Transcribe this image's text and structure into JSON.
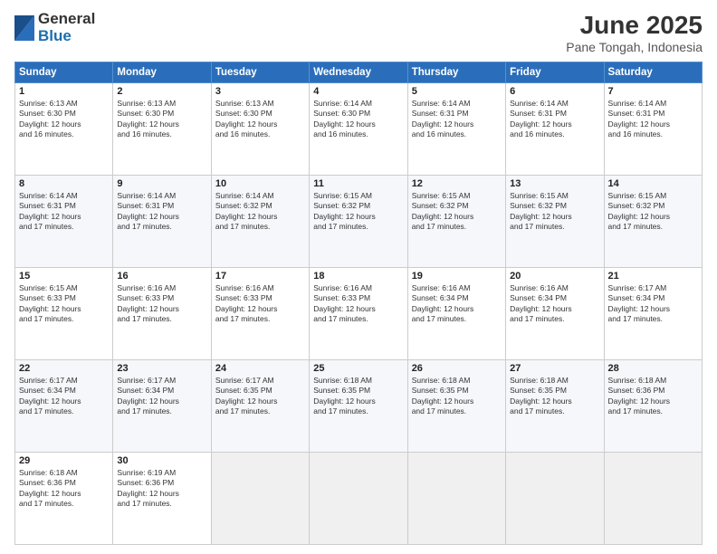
{
  "logo": {
    "general": "General",
    "blue": "Blue"
  },
  "title": "June 2025",
  "location": "Pane Tongah, Indonesia",
  "days_of_week": [
    "Sunday",
    "Monday",
    "Tuesday",
    "Wednesday",
    "Thursday",
    "Friday",
    "Saturday"
  ],
  "weeks": [
    [
      {
        "day": "1",
        "sunrise": "6:13 AM",
        "sunset": "6:30 PM",
        "daylight": "12 hours and 16 minutes."
      },
      {
        "day": "2",
        "sunrise": "6:13 AM",
        "sunset": "6:30 PM",
        "daylight": "12 hours and 16 minutes."
      },
      {
        "day": "3",
        "sunrise": "6:13 AM",
        "sunset": "6:30 PM",
        "daylight": "12 hours and 16 minutes."
      },
      {
        "day": "4",
        "sunrise": "6:14 AM",
        "sunset": "6:30 PM",
        "daylight": "12 hours and 16 minutes."
      },
      {
        "day": "5",
        "sunrise": "6:14 AM",
        "sunset": "6:31 PM",
        "daylight": "12 hours and 16 minutes."
      },
      {
        "day": "6",
        "sunrise": "6:14 AM",
        "sunset": "6:31 PM",
        "daylight": "12 hours and 16 minutes."
      },
      {
        "day": "7",
        "sunrise": "6:14 AM",
        "sunset": "6:31 PM",
        "daylight": "12 hours and 16 minutes."
      }
    ],
    [
      {
        "day": "8",
        "sunrise": "6:14 AM",
        "sunset": "6:31 PM",
        "daylight": "12 hours and 17 minutes."
      },
      {
        "day": "9",
        "sunrise": "6:14 AM",
        "sunset": "6:31 PM",
        "daylight": "12 hours and 17 minutes."
      },
      {
        "day": "10",
        "sunrise": "6:14 AM",
        "sunset": "6:32 PM",
        "daylight": "12 hours and 17 minutes."
      },
      {
        "day": "11",
        "sunrise": "6:15 AM",
        "sunset": "6:32 PM",
        "daylight": "12 hours and 17 minutes."
      },
      {
        "day": "12",
        "sunrise": "6:15 AM",
        "sunset": "6:32 PM",
        "daylight": "12 hours and 17 minutes."
      },
      {
        "day": "13",
        "sunrise": "6:15 AM",
        "sunset": "6:32 PM",
        "daylight": "12 hours and 17 minutes."
      },
      {
        "day": "14",
        "sunrise": "6:15 AM",
        "sunset": "6:32 PM",
        "daylight": "12 hours and 17 minutes."
      }
    ],
    [
      {
        "day": "15",
        "sunrise": "6:15 AM",
        "sunset": "6:33 PM",
        "daylight": "12 hours and 17 minutes."
      },
      {
        "day": "16",
        "sunrise": "6:16 AM",
        "sunset": "6:33 PM",
        "daylight": "12 hours and 17 minutes."
      },
      {
        "day": "17",
        "sunrise": "6:16 AM",
        "sunset": "6:33 PM",
        "daylight": "12 hours and 17 minutes."
      },
      {
        "day": "18",
        "sunrise": "6:16 AM",
        "sunset": "6:33 PM",
        "daylight": "12 hours and 17 minutes."
      },
      {
        "day": "19",
        "sunrise": "6:16 AM",
        "sunset": "6:34 PM",
        "daylight": "12 hours and 17 minutes."
      },
      {
        "day": "20",
        "sunrise": "6:16 AM",
        "sunset": "6:34 PM",
        "daylight": "12 hours and 17 minutes."
      },
      {
        "day": "21",
        "sunrise": "6:17 AM",
        "sunset": "6:34 PM",
        "daylight": "12 hours and 17 minutes."
      }
    ],
    [
      {
        "day": "22",
        "sunrise": "6:17 AM",
        "sunset": "6:34 PM",
        "daylight": "12 hours and 17 minutes."
      },
      {
        "day": "23",
        "sunrise": "6:17 AM",
        "sunset": "6:34 PM",
        "daylight": "12 hours and 17 minutes."
      },
      {
        "day": "24",
        "sunrise": "6:17 AM",
        "sunset": "6:35 PM",
        "daylight": "12 hours and 17 minutes."
      },
      {
        "day": "25",
        "sunrise": "6:18 AM",
        "sunset": "6:35 PM",
        "daylight": "12 hours and 17 minutes."
      },
      {
        "day": "26",
        "sunrise": "6:18 AM",
        "sunset": "6:35 PM",
        "daylight": "12 hours and 17 minutes."
      },
      {
        "day": "27",
        "sunrise": "6:18 AM",
        "sunset": "6:35 PM",
        "daylight": "12 hours and 17 minutes."
      },
      {
        "day": "28",
        "sunrise": "6:18 AM",
        "sunset": "6:36 PM",
        "daylight": "12 hours and 17 minutes."
      }
    ],
    [
      {
        "day": "29",
        "sunrise": "6:18 AM",
        "sunset": "6:36 PM",
        "daylight": "12 hours and 17 minutes."
      },
      {
        "day": "30",
        "sunrise": "6:19 AM",
        "sunset": "6:36 PM",
        "daylight": "12 hours and 17 minutes."
      },
      null,
      null,
      null,
      null,
      null
    ]
  ],
  "labels": {
    "sunrise": "Sunrise:",
    "sunset": "Sunset:",
    "daylight": "Daylight:"
  }
}
